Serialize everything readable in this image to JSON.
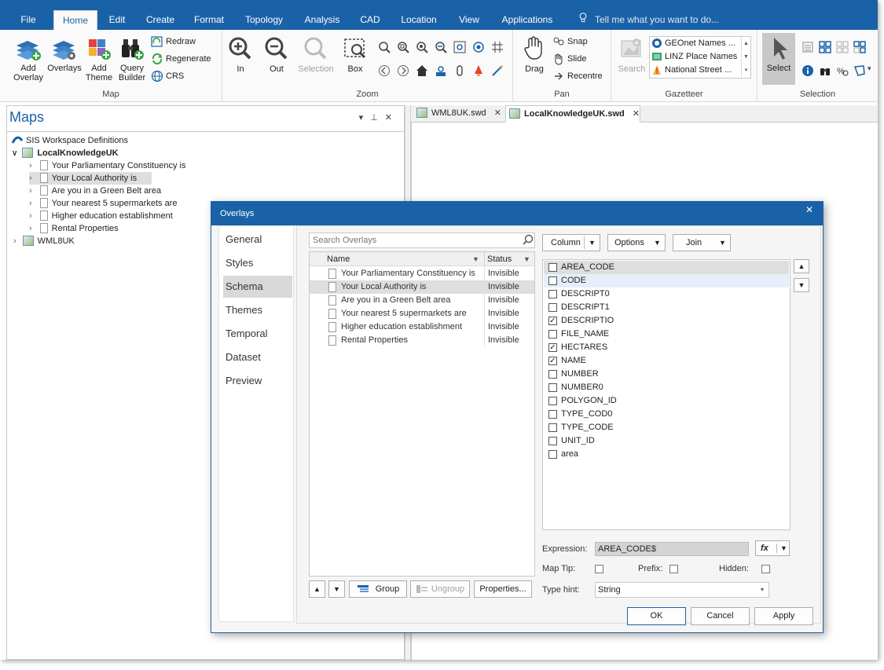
{
  "ribbon_tabs": [
    "File",
    "Home",
    "Edit",
    "Create",
    "Format",
    "Topology",
    "Analysis",
    "CAD",
    "Location",
    "View",
    "Applications"
  ],
  "active_tab": "Home",
  "tell_me": "Tell me what you want to do...",
  "ribbon": {
    "map_group": {
      "label": "Map",
      "add_overlay": "Add Overlay",
      "overlays": "Overlays",
      "add_theme": "Add Theme",
      "query_builder": "Query Builder",
      "redraw": "Redraw",
      "regenerate": "Regenerate",
      "crs": "CRS"
    },
    "zoom_group": {
      "label": "Zoom",
      "in": "In",
      "out": "Out",
      "selection": "Selection",
      "box": "Box"
    },
    "pan_group": {
      "label": "Pan",
      "drag": "Drag",
      "snap": "Snap",
      "slide": "Slide",
      "recentre": "Recentre"
    },
    "gazetteer_group": {
      "label": "Gazetteer",
      "search": "Search",
      "items": [
        "GEOnet Names ...",
        "LINZ Place Names",
        "National Street ..."
      ]
    },
    "selection_group": {
      "label": "Selection",
      "select": "Select"
    }
  },
  "maps_pane": {
    "title": "Maps",
    "root": "SIS Workspace Definitions",
    "workspace": "LocalKnowledgeUK",
    "items": [
      "Your Parliamentary Constituency is",
      "Your Local Authority is",
      "Are you in a Green Belt area",
      "Your nearest 5 supermarkets are",
      "Higher education establishment",
      "Rental Properties"
    ],
    "other": "WML8UK"
  },
  "doc_tabs": [
    "WML8UK.swd",
    "LocalKnowledgeUK.swd"
  ],
  "dialog": {
    "title": "Overlays",
    "nav": [
      "General",
      "Styles",
      "Schema",
      "Themes",
      "Temporal",
      "Dataset",
      "Preview"
    ],
    "active_nav": "Schema",
    "search_placeholder": "Search Overlays",
    "col_name": "Name",
    "col_status": "Status",
    "overlays": [
      {
        "name": "Your Parliamentary Constituency is",
        "status": "Invisible"
      },
      {
        "name": "Your Local Authority is",
        "status": "Invisible"
      },
      {
        "name": "Are you in a Green Belt area",
        "status": "Invisible"
      },
      {
        "name": "Your nearest 5 supermarkets are",
        "status": "Invisible"
      },
      {
        "name": "Higher education establishment",
        "status": "Invisible"
      },
      {
        "name": "Rental Properties",
        "status": "Invisible"
      }
    ],
    "column_btn": "Column",
    "options_btn": "Options",
    "join_btn": "Join",
    "fields": [
      {
        "name": "AREA_CODE",
        "checked": false
      },
      {
        "name": "CODE",
        "checked": false
      },
      {
        "name": "DESCRIPT0",
        "checked": false
      },
      {
        "name": "DESCRIPT1",
        "checked": false
      },
      {
        "name": "DESCRIPTIO",
        "checked": true
      },
      {
        "name": "FILE_NAME",
        "checked": false
      },
      {
        "name": "HECTARES",
        "checked": true
      },
      {
        "name": "NAME",
        "checked": true
      },
      {
        "name": "NUMBER",
        "checked": false
      },
      {
        "name": "NUMBER0",
        "checked": false
      },
      {
        "name": "POLYGON_ID",
        "checked": false
      },
      {
        "name": "TYPE_COD0",
        "checked": false
      },
      {
        "name": "TYPE_CODE",
        "checked": false
      },
      {
        "name": "UNIT_ID",
        "checked": false
      },
      {
        "name": "area",
        "checked": false
      }
    ],
    "expression_label": "Expression:",
    "expression_value": "AREA_CODE$",
    "fx": "fx",
    "maptip_label": "Map Tip:",
    "prefix_label": "Prefix:",
    "hidden_label": "Hidden:",
    "typehint_label": "Type hint:",
    "typehint_value": "String",
    "group_btn": "Group",
    "ungroup_btn": "Ungroup",
    "properties_btn": "Properties...",
    "ok": "OK",
    "cancel": "Cancel",
    "apply": "Apply"
  },
  "colors": {
    "accent": "#1a62a8",
    "selection": "#dedede"
  }
}
